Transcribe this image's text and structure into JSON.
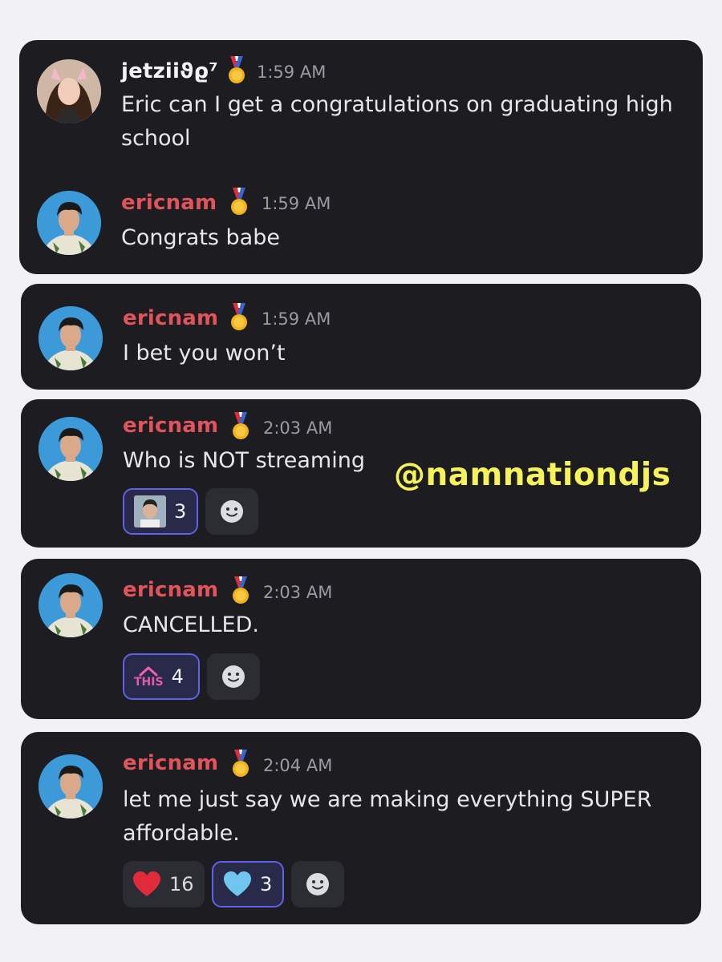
{
  "watermark": "@namnationdjs",
  "messages": [
    {
      "author": "jetziiϑϱ⁷",
      "time": "1:59 AM",
      "text": "Eric can I get a congratulations on graduating high school"
    },
    {
      "author": "ericnam",
      "time": "1:59 AM",
      "text": "Congrats babe"
    },
    {
      "author": "ericnam",
      "time": "1:59 AM",
      "text": "I bet you won’t"
    },
    {
      "author": "ericnam",
      "time": "2:03 AM",
      "text": "Who is NOT streaming",
      "reactions": [
        {
          "emoji": "photo-emoji",
          "count": "3",
          "active": true
        }
      ]
    },
    {
      "author": "ericnam",
      "time": "2:03 AM",
      "text": "CANCELLED.",
      "reactions": [
        {
          "emoji": "this-emoji",
          "label": "THIS",
          "count": "4",
          "active": true
        }
      ]
    },
    {
      "author": "ericnam",
      "time": "2:04 AM",
      "text": "let me just say we are making everything SUPER affordable.",
      "reactions": [
        {
          "emoji": "red-heart-emoji",
          "count": "16",
          "active": false
        },
        {
          "emoji": "light-blue-heart-emoji",
          "count": "3",
          "active": true
        }
      ]
    }
  ],
  "colors": {
    "card": "#1c1c21",
    "username": "#e2545c",
    "accent": "#5d62e8",
    "watermark": "#f5f25a"
  }
}
